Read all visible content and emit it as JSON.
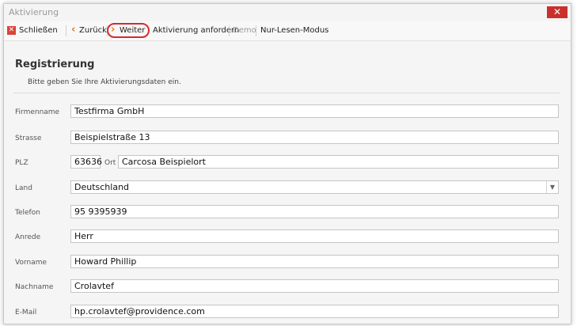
{
  "window": {
    "title": "Aktivierung",
    "close_glyph": "✕"
  },
  "toolbar": {
    "close_label": "Schließen",
    "back_label": "Zurück",
    "next_label": "Weiter",
    "request_label": "Aktivierung anfordern",
    "demo_label": "Demo",
    "readonly_label": "Nur-Lesen-Modus"
  },
  "form": {
    "heading": "Registrierung",
    "subtitle": "Bitte geben Sie Ihre Aktivierungsdaten ein.",
    "firmenname": {
      "label": "Firmenname",
      "value": "Testfirma GmbH"
    },
    "strasse": {
      "label": "Strasse",
      "value": "Beispielstraße 13"
    },
    "plz": {
      "label": "PLZ",
      "value": "63636"
    },
    "ort": {
      "label": "Ort",
      "value": "Carcosa Beispielort"
    },
    "land": {
      "label": "Land",
      "value": "Deutschland"
    },
    "telefon": {
      "label": "Telefon",
      "value": "95 9395939"
    },
    "anrede": {
      "label": "Anrede",
      "value": "Herr"
    },
    "vorname": {
      "label": "Vorname",
      "value": "Howard Phillip"
    },
    "nachname": {
      "label": "Nachname",
      "value": "Crolavtef"
    },
    "email": {
      "label": "E-Mail",
      "value": "hp.crolavtef@providence.com"
    }
  },
  "colors": {
    "close_red": "#c9302c",
    "highlight_ring": "#d62b2b",
    "chevron_orange": "#e07b27"
  }
}
